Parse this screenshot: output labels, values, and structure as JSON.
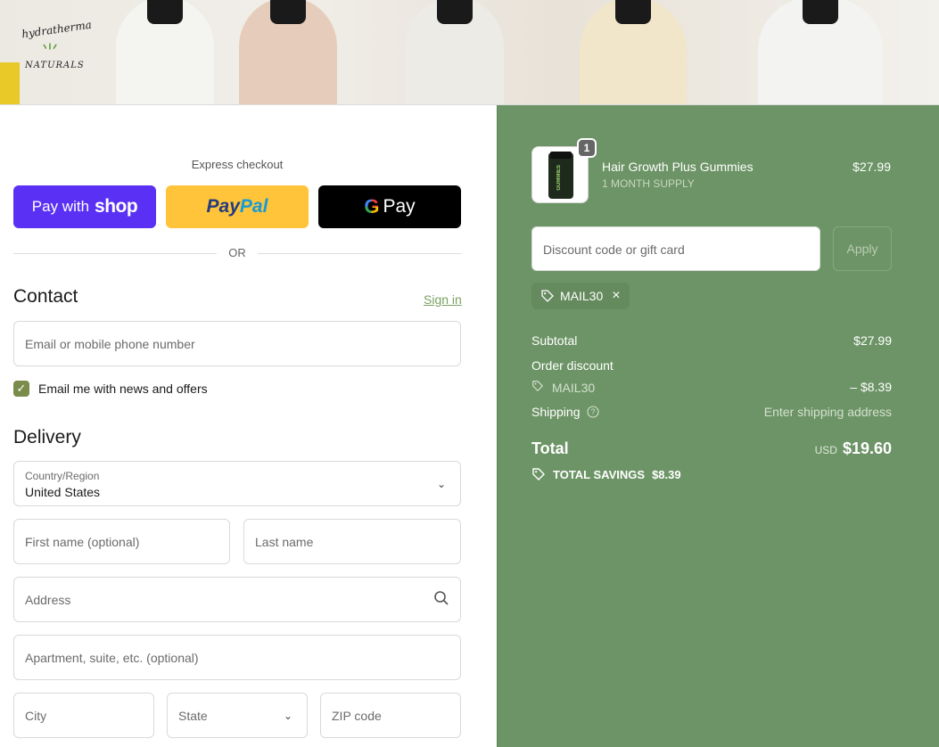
{
  "brand": {
    "logo_line1": "hydratherma",
    "logo_line2": "NATURALS"
  },
  "express": {
    "label": "Express checkout",
    "shop_prefix": "Pay with",
    "shop_brand": "shop",
    "paypal_a": "Pay",
    "paypal_b": "Pal",
    "gpay": "Pay",
    "or": "OR"
  },
  "contact": {
    "title": "Contact",
    "signin": "Sign in",
    "email_placeholder": "Email or mobile phone number",
    "newsletter_label": "Email me with news and offers",
    "newsletter_checked": true
  },
  "delivery": {
    "title": "Delivery",
    "country_label": "Country/Region",
    "country_value": "United States",
    "first_name": "First name (optional)",
    "last_name": "Last name",
    "address": "Address",
    "apartment": "Apartment, suite, etc. (optional)",
    "city": "City",
    "state": "State",
    "zip": "ZIP code"
  },
  "summary": {
    "product": {
      "name": "Hair Growth Plus Gummies",
      "variant": "1 MONTH SUPPLY",
      "price": "$27.99",
      "quantity": "1",
      "jar_text": "GUMMIES"
    },
    "discount_placeholder": "Discount code or gift card",
    "apply": "Apply",
    "code": "MAIL30",
    "subtotal_label": "Subtotal",
    "subtotal": "$27.99",
    "order_discount_label": "Order discount",
    "discount_code": "MAIL30",
    "discount_amount": "– $8.39",
    "shipping_label": "Shipping",
    "shipping_value": "Enter shipping address",
    "total_label": "Total",
    "currency": "USD",
    "total": "$19.60",
    "savings_label": "TOTAL SAVINGS",
    "savings": "$8.39"
  },
  "colors": {
    "accent": "#6d9466",
    "link": "#7aa262",
    "shop": "#5a31f4",
    "paypal": "#ffc439"
  }
}
